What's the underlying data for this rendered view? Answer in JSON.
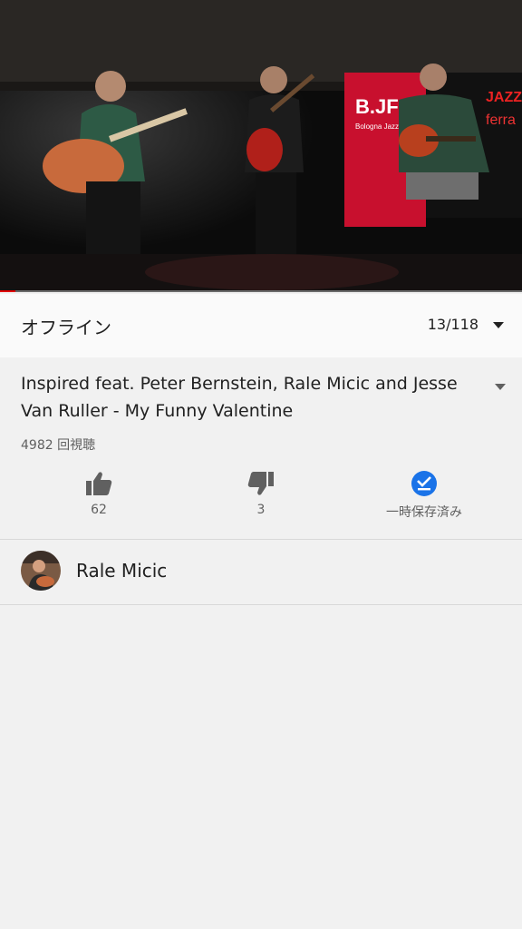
{
  "player": {
    "progress_fraction": 0.03,
    "colors": {
      "progress": "#e00000",
      "track": "#6b6b6b"
    },
    "banner_text": "B.JF",
    "banner_sub": "Bologna Jazz",
    "jazz_text": "JAZZ",
    "club_text": "ferra"
  },
  "playlist": {
    "title": "オフライン",
    "position": "13/118",
    "toggle_icon": "chevron-down-icon"
  },
  "video": {
    "title": "Inspired  feat. Peter Bernstein, Rale Micic and Jesse Van Ruller - My Funny Valentine",
    "views": "4982 回視聴",
    "expand_icon": "chevron-down-icon"
  },
  "actions": {
    "like": {
      "icon": "thumbs-up-icon",
      "label": "62"
    },
    "dislike": {
      "icon": "thumbs-down-icon",
      "label": "3"
    },
    "offline": {
      "icon": "offline-saved-icon",
      "label": "一時保存済み",
      "color": "#1a73e8"
    }
  },
  "channel": {
    "name": "Rale Micic",
    "avatar_icon": "channel-avatar"
  }
}
